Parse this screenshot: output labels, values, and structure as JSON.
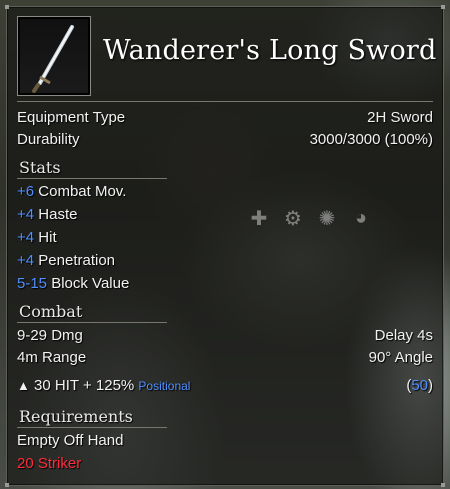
{
  "item": {
    "name": "Wanderer's Long Sword",
    "icon": "sword-icon"
  },
  "info": {
    "equipment_type_label": "Equipment Type",
    "equipment_type_value": "2H Sword",
    "durability_label": "Durability",
    "durability_value": "3000/3000 (100%)"
  },
  "stats": {
    "header": "Stats",
    "lines": [
      {
        "value": "+6",
        "label": "Combat Mov."
      },
      {
        "value": "+4",
        "label": "Haste"
      },
      {
        "value": "+4",
        "label": "Hit"
      },
      {
        "value": "+4",
        "label": "Penetration"
      },
      {
        "value": "5-15",
        "label": "Block Value"
      }
    ]
  },
  "combat": {
    "header": "Combat",
    "damage": "9-29 Dmg",
    "delay": "Delay 4s",
    "range": "4m Range",
    "angle": "90° Angle",
    "hit_text": "30 HIT + 125%",
    "positional": "Positional",
    "paren_open": "(",
    "cost": "50",
    "paren_close": ")"
  },
  "requirements": {
    "header": "Requirements",
    "offhand": "Empty Off Hand",
    "class_req": "20 Striker"
  },
  "action_icons": [
    "plus-icon",
    "gear-icon",
    "cog-icon",
    "globe-icon"
  ],
  "colors": {
    "blue": "#4f8fff",
    "red": "#ff2b3a",
    "text": "#f2f2f2"
  }
}
